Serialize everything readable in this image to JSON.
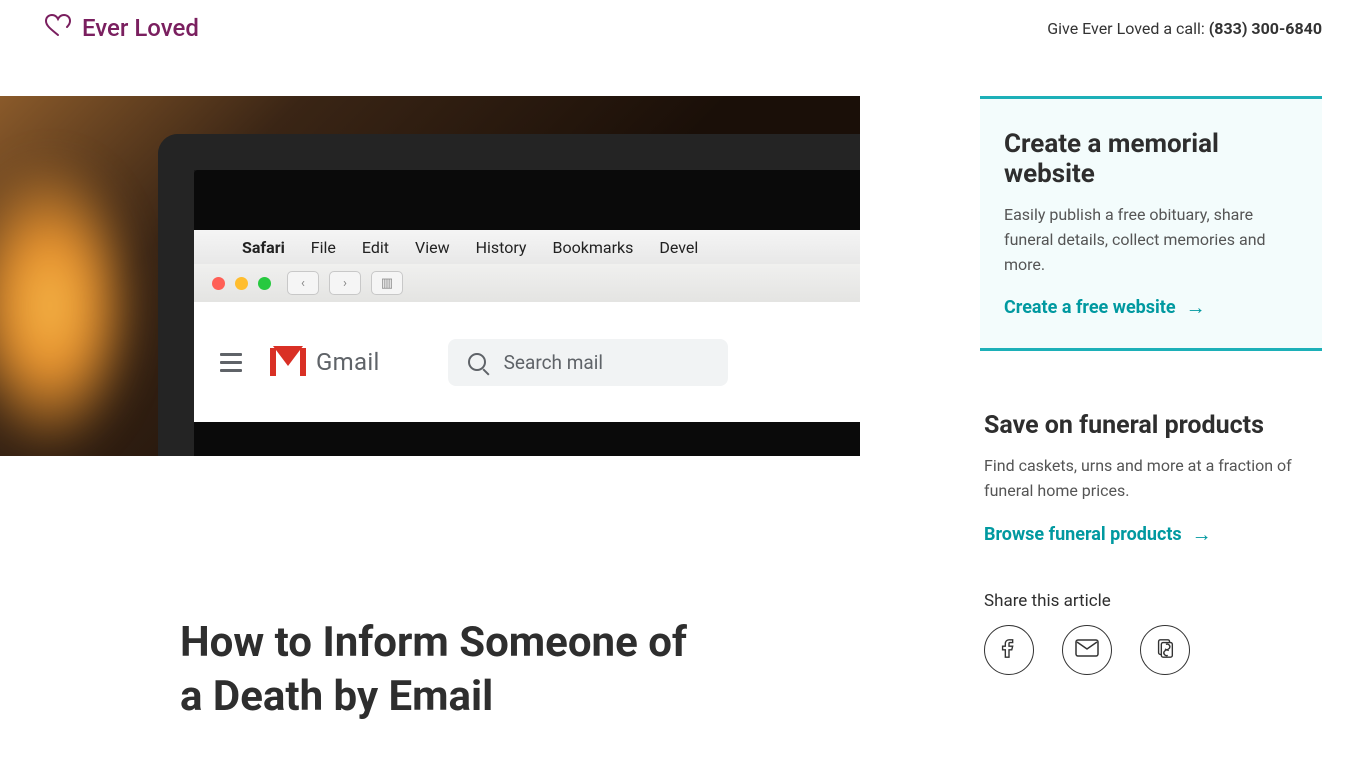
{
  "header": {
    "brand_name": "Ever Loved",
    "call_prefix": "Give Ever Loved a call: ",
    "phone": "(833) 300-6840"
  },
  "hero": {
    "menubar_items": [
      "Safari",
      "File",
      "Edit",
      "View",
      "History",
      "Bookmarks",
      "Devel"
    ],
    "gmail_label": "Gmail",
    "search_placeholder": "Search mail"
  },
  "article": {
    "title": "How to Inform Someone of a Death by Email"
  },
  "sidebar": {
    "create": {
      "title": "Create a memorial website",
      "desc": "Easily publish a free obituary, share funeral details, collect memories and more.",
      "cta": "Create a free website"
    },
    "products": {
      "title": "Save on funeral products",
      "desc": "Find caskets, urns and more at a fraction of funeral home prices.",
      "cta": "Browse funeral products"
    },
    "share": {
      "title": "Share this article"
    }
  }
}
